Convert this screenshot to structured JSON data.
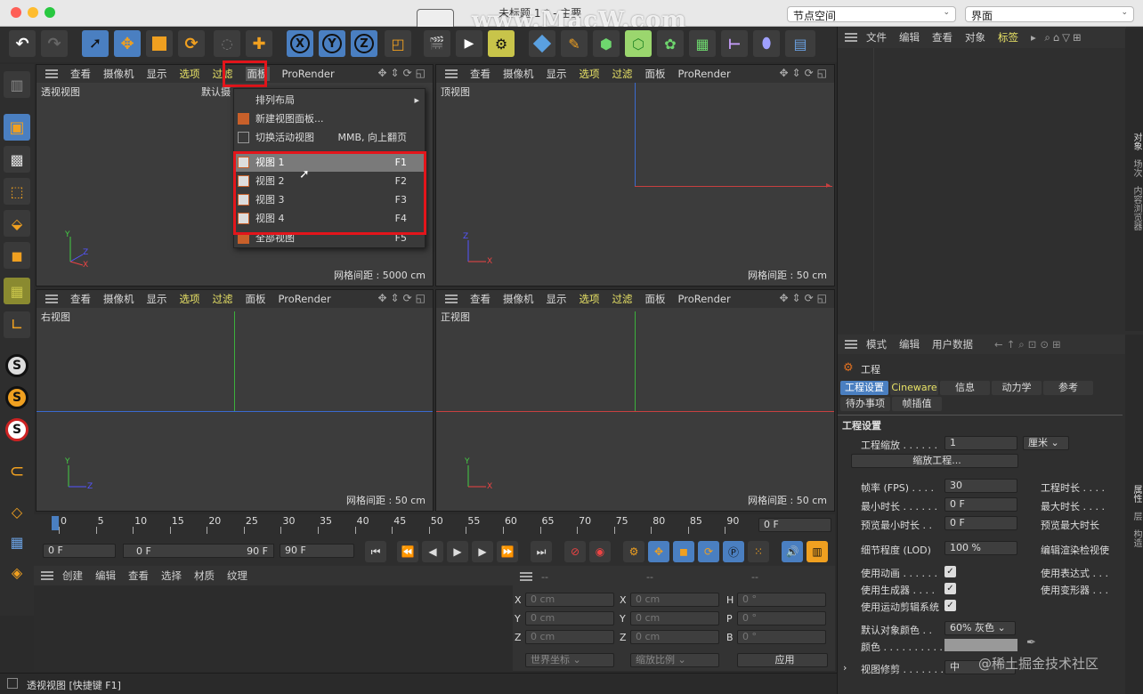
{
  "window": {
    "title": "未标题 1 * - 主要",
    "watermark": "www.MacW.com",
    "layout_select": "节点空间",
    "interface_select": "界面"
  },
  "viewport_menu": {
    "items": [
      "查看",
      "摄像机",
      "显示",
      "选项",
      "过滤",
      "面板",
      "ProRender"
    ]
  },
  "viewports": [
    {
      "name": "透视视图",
      "secondary": "默认摄",
      "grid": "网格间距 : 5000 cm"
    },
    {
      "name": "顶视图",
      "grid": "网格间距 : 50 cm"
    },
    {
      "name": "右视图",
      "grid": "网格间距 : 50 cm"
    },
    {
      "name": "正视图",
      "grid": "网格间距 : 50 cm"
    }
  ],
  "panel_menu": {
    "items": [
      {
        "label": "排列布局",
        "shortcut": "▸"
      },
      {
        "label": "新建视图面板...",
        "shortcut": ""
      },
      {
        "label": "切换活动视图",
        "shortcut": "MMB, 向上翻页"
      },
      {
        "label": "视图 1",
        "shortcut": "F1"
      },
      {
        "label": "视图 2",
        "shortcut": "F2"
      },
      {
        "label": "视图 3",
        "shortcut": "F3"
      },
      {
        "label": "视图 4",
        "shortcut": "F4"
      },
      {
        "label": "全部视图",
        "shortcut": "F5"
      }
    ]
  },
  "object_manager": {
    "menu": [
      "文件",
      "编辑",
      "查看",
      "对象",
      "标签"
    ]
  },
  "right_tabs": {
    "top": [
      "对象",
      "场次",
      "内容浏览器"
    ],
    "bottom": [
      "属性",
      "层",
      "构造"
    ]
  },
  "attributes": {
    "menu": [
      "模式",
      "编辑",
      "用户数据"
    ],
    "object": "工程",
    "tabs_row1": [
      "工程设置",
      "Cineware",
      "信息",
      "动力学",
      "参考"
    ],
    "tabs_row2": [
      "待办事项",
      "帧插值"
    ],
    "section": "工程设置",
    "scale_label": "工程缩放 . . . . . .",
    "scale_value": "1",
    "scale_unit": "厘米",
    "scale_button": "缩放工程...",
    "fps_label": "帧率 (FPS) . . . .",
    "fps_value": "30",
    "min_time_label": "最小时长 . . . . . .",
    "min_time_value": "0 F",
    "preview_min_label": "预览最小时长 . .",
    "preview_min_value": "0 F",
    "project_time": "工程时长 . . . .",
    "max_time": "最大时长 . . . .",
    "preview_max": "预览最大时长",
    "lod_label": "细节程度 (LOD)",
    "lod_value": "100 %",
    "render_lod": "编辑渲染检视使",
    "use_anim": "使用动画 . . . . . .",
    "use_gen": "使用生成器 . . . .",
    "use_motion": "使用运动剪辑系统",
    "use_expr": "使用表达式 . . .",
    "use_deform": "使用变形器 . . .",
    "default_color_label": "默认对象颜色 . .",
    "default_color_value": "60% 灰色",
    "color_label": "颜色 . . . . . . . . . .",
    "view_clip_label": "视图修剪 . . . . . . .",
    "view_clip_value": "中",
    "site_watermark": "@稀土掘金技术社区"
  },
  "timeline": {
    "ticks": [
      "0",
      "5",
      "10",
      "15",
      "20",
      "25",
      "30",
      "35",
      "40",
      "45",
      "50",
      "55",
      "60",
      "65",
      "70",
      "75",
      "80",
      "85",
      "90"
    ],
    "current": "0 F",
    "start": "0 F",
    "range_start": "0 F",
    "range_end": "90 F",
    "end": "90 F"
  },
  "material_manager": {
    "menu": [
      "创建",
      "编辑",
      "查看",
      "选择",
      "材质",
      "纹理"
    ]
  },
  "coordinates": {
    "header": [
      "--",
      "--",
      "--"
    ],
    "rows": [
      {
        "a": "X",
        "av": "0 cm",
        "b": "X",
        "bv": "0 cm",
        "c": "H",
        "cv": "0 °"
      },
      {
        "a": "Y",
        "av": "0 cm",
        "b": "Y",
        "bv": "0 cm",
        "c": "P",
        "cv": "0 °"
      },
      {
        "a": "Z",
        "av": "0 cm",
        "b": "Z",
        "bv": "0 cm",
        "c": "B",
        "cv": "0 °"
      }
    ],
    "world": "世界坐标",
    "scale": "缩放比例",
    "apply": "应用"
  },
  "status": "透视视图 [快捷键 F1]",
  "colors": {
    "accent": "#4a7fc1",
    "highlight": "#e3151b",
    "menu_yellow": "#e8e266"
  }
}
